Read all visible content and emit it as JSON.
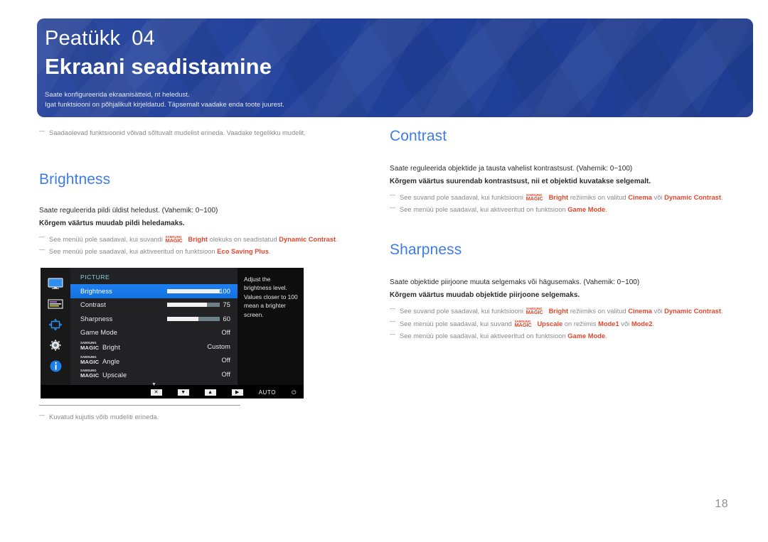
{
  "header": {
    "chapter_word": "Peatükk",
    "chapter_number": "04",
    "title": "Ekraani seadistamine",
    "sub1": "Saate konfigureerida ekraanisätteid, nt heledust.",
    "sub2": "Igat funktsiooni on põhjalikult kirjeldatud. Täpsemalt vaadake enda toote juurest.",
    "brand_blue": "#21409A"
  },
  "top_note": "Saadaolevad funktsioonid võivad sõltuvalt mudelist erineda. Vaadake tegelikku mudelit.",
  "left": {
    "section_title": "Brightness",
    "body1": "Saate reguleerida pildi üldist heledust. (Vahemik: 0~100)",
    "body2": "Kõrgem väärtus muudab pildi heledamaks.",
    "note1_pre": "See menüü pole saadaval, kui suvandi",
    "note1_mid": "olekuks on seadistatud",
    "note1_hl": "Dynamic Contrast",
    "note1_end": ".",
    "note1_magic_small": "SAMSUNG",
    "note1_magic_main": "MAGIC",
    "note1_magic_suffix": "Bright",
    "note2_pre": "See menüü pole saadaval, kui aktiveeritud on funktsioon",
    "note2_hl": "Eco Saving Plus",
    "note2_end": ".",
    "caption_note": "Kuvatud kujutis võib mudeliti erineda."
  },
  "right": {
    "contrast": {
      "section_title": "Contrast",
      "body1": "Saate reguleerida objektide ja tausta vahelist kontrastsust. (Vahemik: 0~100)",
      "body2": "Kõrgem väärtus suurendab kontrastsust, nii et objektid kuvatakse selgemalt.",
      "note1_pre": "See suvand pole saadaval, kui funktsiooni",
      "note1_mid": "režiimiks on valitud",
      "note1_hl1": "Cinema",
      "note1_or": "või",
      "note1_hl2": "Dynamic Contrast",
      "note1_end": ".",
      "note2_pre": "See menüü pole saadaval, kui aktiveeritud on funktsioon",
      "note2_hl": "Game Mode",
      "note2_end": "."
    },
    "sharpness": {
      "section_title": "Sharpness",
      "body1": "Saate objektide piirjoone muuta selgemaks või hägusemaks. (Vahemik: 0~100)",
      "body2": "Kõrgem väärtus muudab objektide piirjoone selgemaks.",
      "note1_pre": "See suvand pole saadaval, kui funktsiooni",
      "note1_mid": "režiimiks on valitud",
      "note1_hl1": "Cinema",
      "note1_or": "või",
      "note1_hl2": "Dynamic Contrast",
      "note1_end": ".",
      "note2_pre": "See menüü pole saadaval, kui suvand",
      "note2_mid": "on režiimis",
      "note2_hl1": "Mode1",
      "note2_or": "või",
      "note2_hl2": "Mode2",
      "note2_end": ".",
      "note2_magic_suffix": "Upscale",
      "note3_pre": "See menüü pole saadaval, kui aktiveeritud on funktsioon",
      "note3_hl": "Game Mode",
      "note3_end": "."
    }
  },
  "osd": {
    "menu_heading": "PICTURE",
    "magic_small": "SAMSUNG",
    "magic_main": "MAGIC",
    "rows": [
      {
        "label": "Brightness",
        "value": "100",
        "bar": 100,
        "selected": true,
        "magic": false
      },
      {
        "label": "Contrast",
        "value": "75",
        "bar": 75,
        "selected": false,
        "magic": false
      },
      {
        "label": "Sharpness",
        "value": "60",
        "bar": 60,
        "selected": false,
        "magic": false
      },
      {
        "label": "Game Mode",
        "value": "Off",
        "bar": null,
        "selected": false,
        "magic": false
      },
      {
        "label": "Bright",
        "value": "Custom",
        "bar": null,
        "selected": false,
        "magic": true
      },
      {
        "label": "Angle",
        "value": "Off",
        "bar": null,
        "selected": false,
        "magic": true
      },
      {
        "label": "Upscale",
        "value": "Off",
        "bar": null,
        "selected": false,
        "magic": true
      }
    ],
    "more_glyph": "▼",
    "help_text": "Adjust the brightness level. Values closer to 100 mean a brighter screen.",
    "sidebar_icons": [
      "picture-icon",
      "onscreen-display-icon",
      "system-icon",
      "setup-and-reset-icon",
      "information-icon"
    ],
    "bottom_keys": [
      "✕",
      "▼",
      "▲",
      "▶"
    ],
    "bottom_auto": "AUTO",
    "bottom_power": "⏻",
    "accent_selected": "#1e7ff0"
  },
  "page_number": "18"
}
